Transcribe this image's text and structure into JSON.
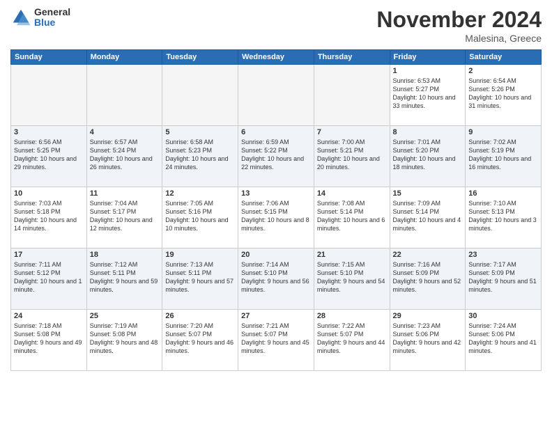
{
  "logo": {
    "general": "General",
    "blue": "Blue"
  },
  "title": "November 2024",
  "location": "Malesina, Greece",
  "weekdays": [
    "Sunday",
    "Monday",
    "Tuesday",
    "Wednesday",
    "Thursday",
    "Friday",
    "Saturday"
  ],
  "weeks": [
    [
      {
        "day": "",
        "info": ""
      },
      {
        "day": "",
        "info": ""
      },
      {
        "day": "",
        "info": ""
      },
      {
        "day": "",
        "info": ""
      },
      {
        "day": "",
        "info": ""
      },
      {
        "day": "1",
        "info": "Sunrise: 6:53 AM\nSunset: 5:27 PM\nDaylight: 10 hours and 33 minutes."
      },
      {
        "day": "2",
        "info": "Sunrise: 6:54 AM\nSunset: 5:26 PM\nDaylight: 10 hours and 31 minutes."
      }
    ],
    [
      {
        "day": "3",
        "info": "Sunrise: 6:56 AM\nSunset: 5:25 PM\nDaylight: 10 hours and 29 minutes."
      },
      {
        "day": "4",
        "info": "Sunrise: 6:57 AM\nSunset: 5:24 PM\nDaylight: 10 hours and 26 minutes."
      },
      {
        "day": "5",
        "info": "Sunrise: 6:58 AM\nSunset: 5:23 PM\nDaylight: 10 hours and 24 minutes."
      },
      {
        "day": "6",
        "info": "Sunrise: 6:59 AM\nSunset: 5:22 PM\nDaylight: 10 hours and 22 minutes."
      },
      {
        "day": "7",
        "info": "Sunrise: 7:00 AM\nSunset: 5:21 PM\nDaylight: 10 hours and 20 minutes."
      },
      {
        "day": "8",
        "info": "Sunrise: 7:01 AM\nSunset: 5:20 PM\nDaylight: 10 hours and 18 minutes."
      },
      {
        "day": "9",
        "info": "Sunrise: 7:02 AM\nSunset: 5:19 PM\nDaylight: 10 hours and 16 minutes."
      }
    ],
    [
      {
        "day": "10",
        "info": "Sunrise: 7:03 AM\nSunset: 5:18 PM\nDaylight: 10 hours and 14 minutes."
      },
      {
        "day": "11",
        "info": "Sunrise: 7:04 AM\nSunset: 5:17 PM\nDaylight: 10 hours and 12 minutes."
      },
      {
        "day": "12",
        "info": "Sunrise: 7:05 AM\nSunset: 5:16 PM\nDaylight: 10 hours and 10 minutes."
      },
      {
        "day": "13",
        "info": "Sunrise: 7:06 AM\nSunset: 5:15 PM\nDaylight: 10 hours and 8 minutes."
      },
      {
        "day": "14",
        "info": "Sunrise: 7:08 AM\nSunset: 5:14 PM\nDaylight: 10 hours and 6 minutes."
      },
      {
        "day": "15",
        "info": "Sunrise: 7:09 AM\nSunset: 5:14 PM\nDaylight: 10 hours and 4 minutes."
      },
      {
        "day": "16",
        "info": "Sunrise: 7:10 AM\nSunset: 5:13 PM\nDaylight: 10 hours and 3 minutes."
      }
    ],
    [
      {
        "day": "17",
        "info": "Sunrise: 7:11 AM\nSunset: 5:12 PM\nDaylight: 10 hours and 1 minute."
      },
      {
        "day": "18",
        "info": "Sunrise: 7:12 AM\nSunset: 5:11 PM\nDaylight: 9 hours and 59 minutes."
      },
      {
        "day": "19",
        "info": "Sunrise: 7:13 AM\nSunset: 5:11 PM\nDaylight: 9 hours and 57 minutes."
      },
      {
        "day": "20",
        "info": "Sunrise: 7:14 AM\nSunset: 5:10 PM\nDaylight: 9 hours and 56 minutes."
      },
      {
        "day": "21",
        "info": "Sunrise: 7:15 AM\nSunset: 5:10 PM\nDaylight: 9 hours and 54 minutes."
      },
      {
        "day": "22",
        "info": "Sunrise: 7:16 AM\nSunset: 5:09 PM\nDaylight: 9 hours and 52 minutes."
      },
      {
        "day": "23",
        "info": "Sunrise: 7:17 AM\nSunset: 5:09 PM\nDaylight: 9 hours and 51 minutes."
      }
    ],
    [
      {
        "day": "24",
        "info": "Sunrise: 7:18 AM\nSunset: 5:08 PM\nDaylight: 9 hours and 49 minutes."
      },
      {
        "day": "25",
        "info": "Sunrise: 7:19 AM\nSunset: 5:08 PM\nDaylight: 9 hours and 48 minutes."
      },
      {
        "day": "26",
        "info": "Sunrise: 7:20 AM\nSunset: 5:07 PM\nDaylight: 9 hours and 46 minutes."
      },
      {
        "day": "27",
        "info": "Sunrise: 7:21 AM\nSunset: 5:07 PM\nDaylight: 9 hours and 45 minutes."
      },
      {
        "day": "28",
        "info": "Sunrise: 7:22 AM\nSunset: 5:07 PM\nDaylight: 9 hours and 44 minutes."
      },
      {
        "day": "29",
        "info": "Sunrise: 7:23 AM\nSunset: 5:06 PM\nDaylight: 9 hours and 42 minutes."
      },
      {
        "day": "30",
        "info": "Sunrise: 7:24 AM\nSunset: 5:06 PM\nDaylight: 9 hours and 41 minutes."
      }
    ]
  ]
}
